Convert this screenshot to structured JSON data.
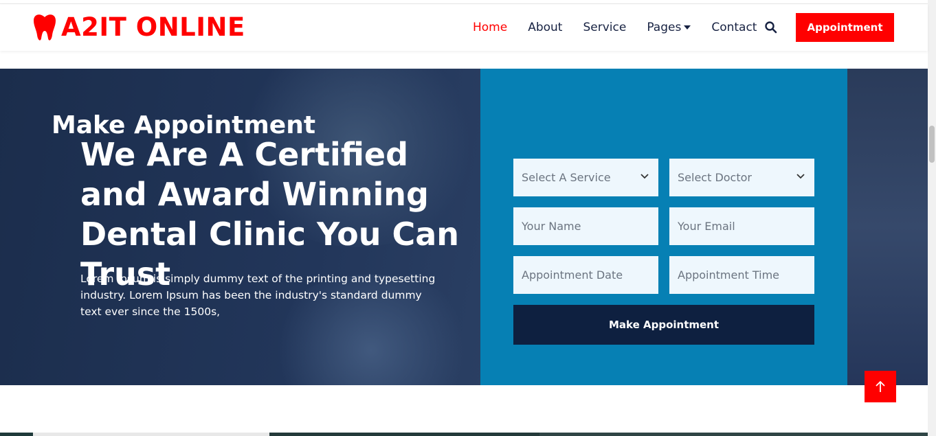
{
  "brand": {
    "name": "A2IT ONLINE",
    "icon": "tooth-icon",
    "color": "#ff0000"
  },
  "nav": {
    "items": [
      {
        "label": "Home",
        "active": true
      },
      {
        "label": "About",
        "active": false
      },
      {
        "label": "Service",
        "active": false
      },
      {
        "label": "Pages",
        "active": false,
        "dropdown": true
      },
      {
        "label": "Contact",
        "active": false
      }
    ],
    "search_icon": "search-icon",
    "appointment_label": "Appointment"
  },
  "hero": {
    "title": "We Are A Certified and Award Winning Dental Clinic You Can Trust",
    "description": "Lorem Ipsum is simply dummy text of the printing and typesetting industry. Lorem Ipsum has been the industry's standard dummy text ever since the 1500s,"
  },
  "appointment_form": {
    "title": "Make Appointment",
    "service_select": "Select A Service",
    "doctor_select": "Select Doctor",
    "name_placeholder": "Your Name",
    "email_placeholder": "Your Email",
    "date_placeholder": "Appointment Date",
    "time_placeholder": "Appointment Time",
    "submit_label": "Make Appointment"
  },
  "back_to_top_icon": "arrow-up-icon",
  "colors": {
    "accent": "#ff0000",
    "panel": "#0680b4",
    "submit": "#0e2040",
    "field_bg": "#eef7fd"
  }
}
